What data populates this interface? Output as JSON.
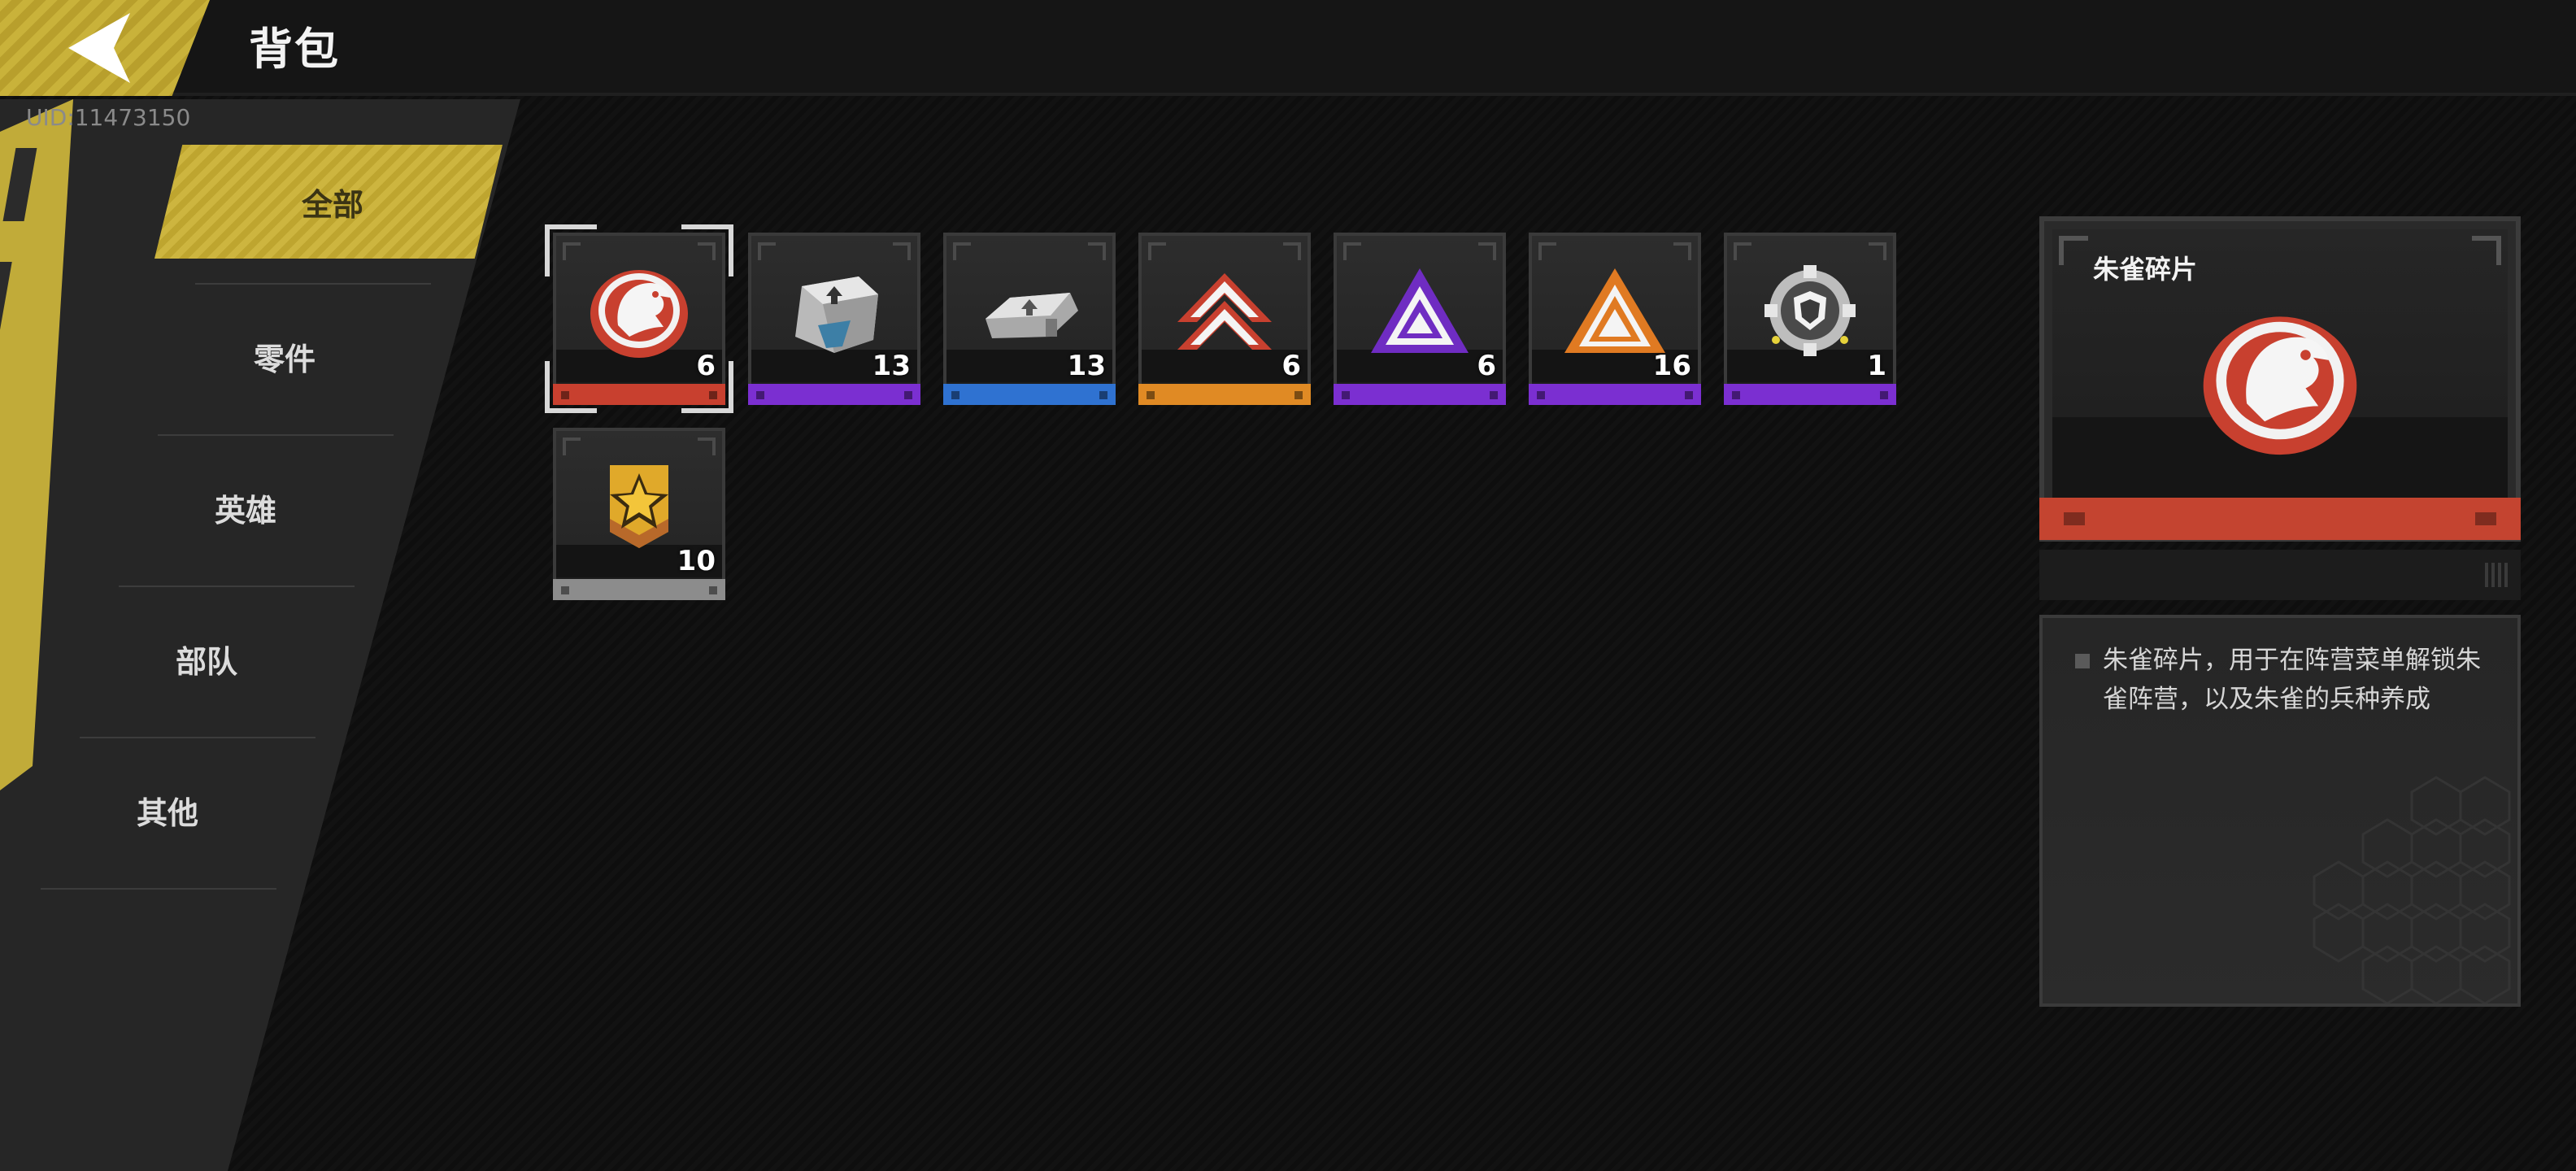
{
  "header": {
    "title": "背包",
    "back_icon": "back-arrow-icon"
  },
  "user": {
    "uid": "UID:11473150"
  },
  "nav": {
    "items": [
      {
        "label": "全部",
        "active": true
      },
      {
        "label": "零件",
        "active": false
      },
      {
        "label": "英雄",
        "active": false
      },
      {
        "label": "部队",
        "active": false
      },
      {
        "label": "其他",
        "active": false
      }
    ]
  },
  "inventory": {
    "items": [
      {
        "icon": "phoenix-emblem-icon",
        "count": "6",
        "rarity_color": "#c8402f",
        "selected": true
      },
      {
        "icon": "silver-part-crate-icon",
        "count": "13",
        "rarity_color": "#7b2fd1"
      },
      {
        "icon": "silver-part-plate-icon",
        "count": "13",
        "rarity_color": "#2f72d1"
      },
      {
        "icon": "red-chevron-icon",
        "count": "6",
        "rarity_color": "#e08a24"
      },
      {
        "icon": "purple-triangle-icon",
        "count": "6",
        "rarity_color": "#7b2fd1"
      },
      {
        "icon": "orange-triangle-icon",
        "count": "16",
        "rarity_color": "#7b2fd1"
      },
      {
        "icon": "shield-gear-icon",
        "count": "1",
        "rarity_color": "#7b2fd1"
      },
      {
        "icon": "gold-star-badge-icon",
        "count": "10",
        "rarity_color": "#8c8c8c"
      }
    ]
  },
  "detail": {
    "name": "朱雀碎片",
    "icon": "phoenix-emblem-icon",
    "rarity_color": "#c44430",
    "description": "朱雀碎片，用于在阵营菜单解锁朱雀阵营，以及朱雀的兵种养成"
  }
}
